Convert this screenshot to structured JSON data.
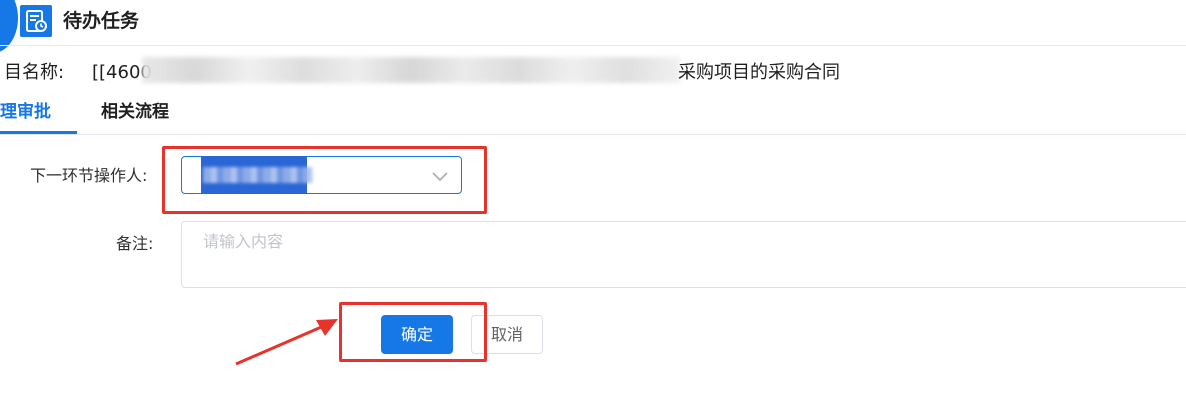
{
  "header": {
    "title": "待办任务",
    "icon": "task-list-icon",
    "accent_color": "#1677e6"
  },
  "project": {
    "label": "目名称:",
    "value_prefix": "[[4600",
    "value_suffix": "采购项目的采购合同"
  },
  "tabs": [
    {
      "label": "理审批",
      "active": true
    },
    {
      "label": "相关流程",
      "active": false
    }
  ],
  "form": {
    "next_operator": {
      "label": "下一环节操作人:",
      "value": "",
      "icon": "chevron-down-icon"
    },
    "remark": {
      "label": "备注:",
      "placeholder": "请输入内容",
      "value": ""
    }
  },
  "buttons": {
    "confirm": "确定",
    "cancel": "取消"
  },
  "annotations": {
    "highlight_color": "#e8322c"
  }
}
